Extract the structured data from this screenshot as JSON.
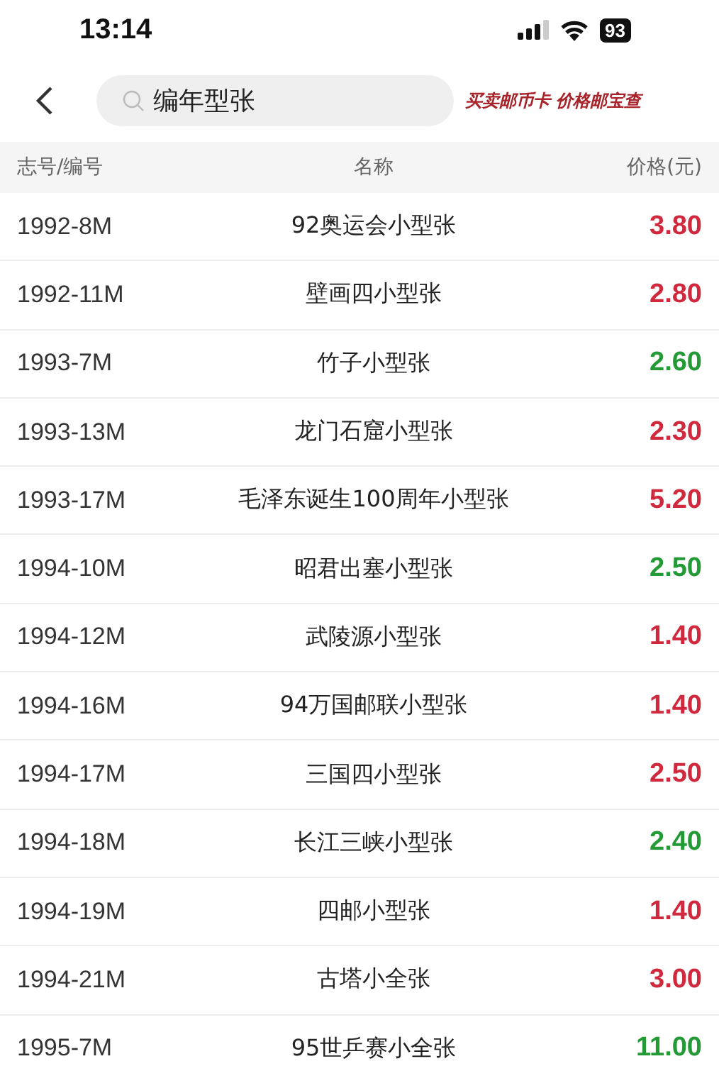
{
  "status_bar": {
    "time": "13:14",
    "battery": "93"
  },
  "nav": {
    "search": {
      "value": "编年型张"
    },
    "slogan": "买卖邮币卡 价格邮宝查"
  },
  "table": {
    "columns": [
      "志号/编号",
      "名称",
      "价格(元)"
    ],
    "rows": [
      {
        "code": "1992-8M",
        "name": "92奥运会小型张",
        "price": "3.80",
        "color": "#d0283c"
      },
      {
        "code": "1992-11M",
        "name": "壁画四小型张",
        "price": "2.80",
        "color": "#d0283c"
      },
      {
        "code": "1993-7M",
        "name": "竹子小型张",
        "price": "2.60",
        "color": "#239a36"
      },
      {
        "code": "1993-13M",
        "name": "龙门石窟小型张",
        "price": "2.30",
        "color": "#d0283c"
      },
      {
        "code": "1993-17M",
        "name": "毛泽东诞生100周年小型张",
        "price": "5.20",
        "color": "#d0283c"
      },
      {
        "code": "1994-10M",
        "name": "昭君出塞小型张",
        "price": "2.50",
        "color": "#239a36"
      },
      {
        "code": "1994-12M",
        "name": "武陵源小型张",
        "price": "1.40",
        "color": "#d0283c"
      },
      {
        "code": "1994-16M",
        "name": "94万国邮联小型张",
        "price": "1.40",
        "color": "#d0283c"
      },
      {
        "code": "1994-17M",
        "name": "三国四小型张",
        "price": "2.50",
        "color": "#d0283c"
      },
      {
        "code": "1994-18M",
        "name": "长江三峡小型张",
        "price": "2.40",
        "color": "#239a36"
      },
      {
        "code": "1994-19M",
        "name": "四邮小型张",
        "price": "1.40",
        "color": "#d0283c"
      },
      {
        "code": "1994-21M",
        "name": "古塔小全张",
        "price": "3.00",
        "color": "#d0283c"
      },
      {
        "code": "1995-7M",
        "name": "95世乒赛小全张",
        "price": "11.00",
        "color": "#239a36"
      }
    ]
  }
}
